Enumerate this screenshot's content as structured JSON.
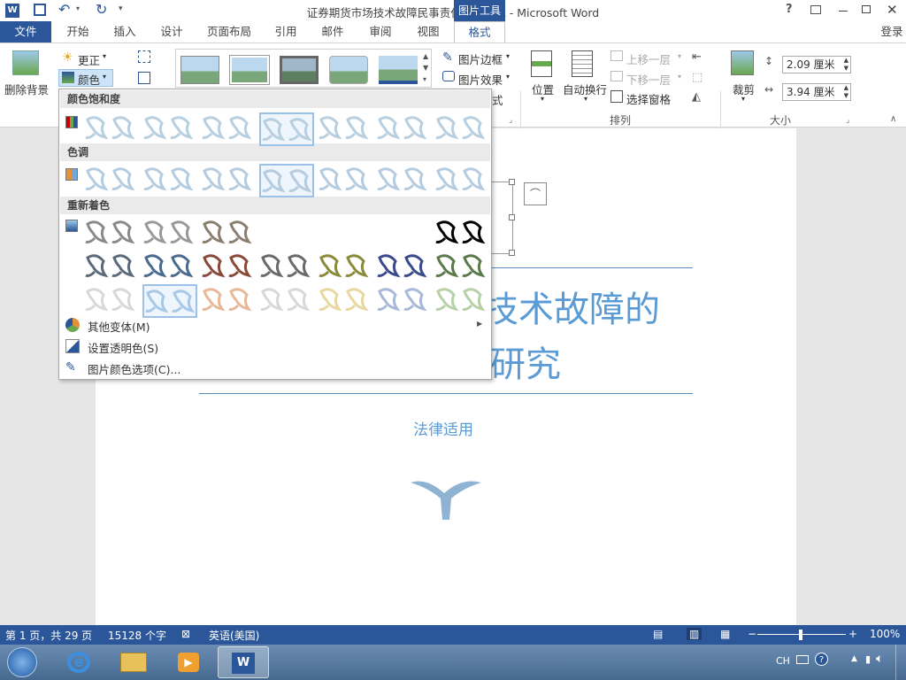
{
  "titlebar": {
    "title": "证券期货市场技术故障民事责任问题研究 - Microsoft Word",
    "help": "?",
    "login": "登录"
  },
  "tabs": [
    "文件",
    "开始",
    "插入",
    "设计",
    "页面布局",
    "引用",
    "邮件",
    "审阅",
    "视图",
    "格式"
  ],
  "picture_tools": "图片工具",
  "ribbon": {
    "remove_bg": "删除背景",
    "corrections": "更正",
    "color": "颜色",
    "artistic_suffix": "式",
    "border": "图片边框",
    "effects": "图片效果",
    "position": "位置",
    "wrap": "自动换行",
    "bring_forward": "上移一层",
    "send_backward": "下移一层",
    "selection_pane": "选择窗格",
    "arrange_label": "排列",
    "crop": "裁剪",
    "height": "2.09 厘米",
    "width": "3.94 厘米",
    "size_label": "大小"
  },
  "color_menu": {
    "saturation_header": "颜色饱和度",
    "tone_header": "色调",
    "recolor_header": "重新着色",
    "more_variations": "其他变体(M)",
    "set_transparent": "设置透明色(S)",
    "picture_color_options": "图片颜色选项(C)..."
  },
  "document": {
    "title_line1": "技术故障的",
    "title_line2": "研究",
    "subtitle": "法律适用"
  },
  "statusbar": {
    "page": "第 1 页，共 29 页",
    "words": "15128 个字",
    "language": "英语(美国)",
    "zoom": "100%"
  },
  "taskbar": {
    "lang": "CH"
  },
  "colors": {
    "word_blue": "#2b579a",
    "doc_blue": "#5b9bd5"
  }
}
